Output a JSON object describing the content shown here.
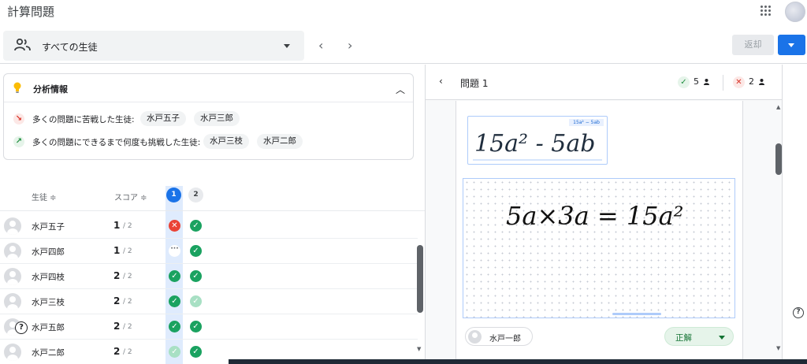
{
  "app": {
    "title": "計算問題"
  },
  "filter": {
    "selected_student": "すべての生徒",
    "nav_prev": "‹",
    "nav_next": "›",
    "return_label": "返却"
  },
  "analysis": {
    "title": "分析情報",
    "struggled": {
      "label": "多くの問題に苦戦した生徒:",
      "students": [
        "水戸五子",
        "水戸三郎"
      ]
    },
    "retried": {
      "label": "多くの問題にできるまで何度も挑戦した生徒:",
      "students": [
        "水戸三枝",
        "水戸二郎"
      ]
    }
  },
  "table": {
    "col_student": "生徒 ≑",
    "col_score": "スコア ≑",
    "questions": [
      "1",
      "2"
    ],
    "rows": [
      {
        "name": "水戸五子",
        "score": "1",
        "total": "/ 2",
        "marks": [
          "ng",
          "ok"
        ]
      },
      {
        "name": "水戸四郎",
        "score": "1",
        "total": "/ 2",
        "marks": [
          "pending",
          "ok"
        ]
      },
      {
        "name": "水戸四枝",
        "score": "2",
        "total": "/ 2",
        "marks": [
          "ok",
          "ok"
        ]
      },
      {
        "name": "水戸三枝",
        "score": "2",
        "total": "/ 2",
        "marks": [
          "ok",
          "ok-light"
        ]
      },
      {
        "name": "水戸五郎",
        "score": "2",
        "total": "/ 2",
        "marks": [
          "ok",
          "ok"
        ]
      },
      {
        "name": "水戸二郎",
        "score": "2",
        "total": "/ 2",
        "marks": [
          "ok-light",
          "ok"
        ]
      }
    ]
  },
  "question": {
    "title": "問題 1",
    "correct_count": "5",
    "incorrect_count": "2",
    "expected_answer_tag": "15a² − 5ab",
    "handwritten_answer": "15a² - 5ab",
    "handwritten_work": "5a×3a = 15a²",
    "student": "水戸一郎",
    "grade": "正解"
  },
  "icons": {
    "people": "people-icon",
    "bulb": "lightbulb-icon",
    "struggle": "trending-down-icon",
    "retry": "trending-up-icon",
    "help": "help-icon",
    "apps": "apps-icon"
  },
  "colors": {
    "accent": "#1a73e8",
    "ok": "#1aa260",
    "ng": "#ea4335",
    "bulb": "#fbbc04"
  }
}
